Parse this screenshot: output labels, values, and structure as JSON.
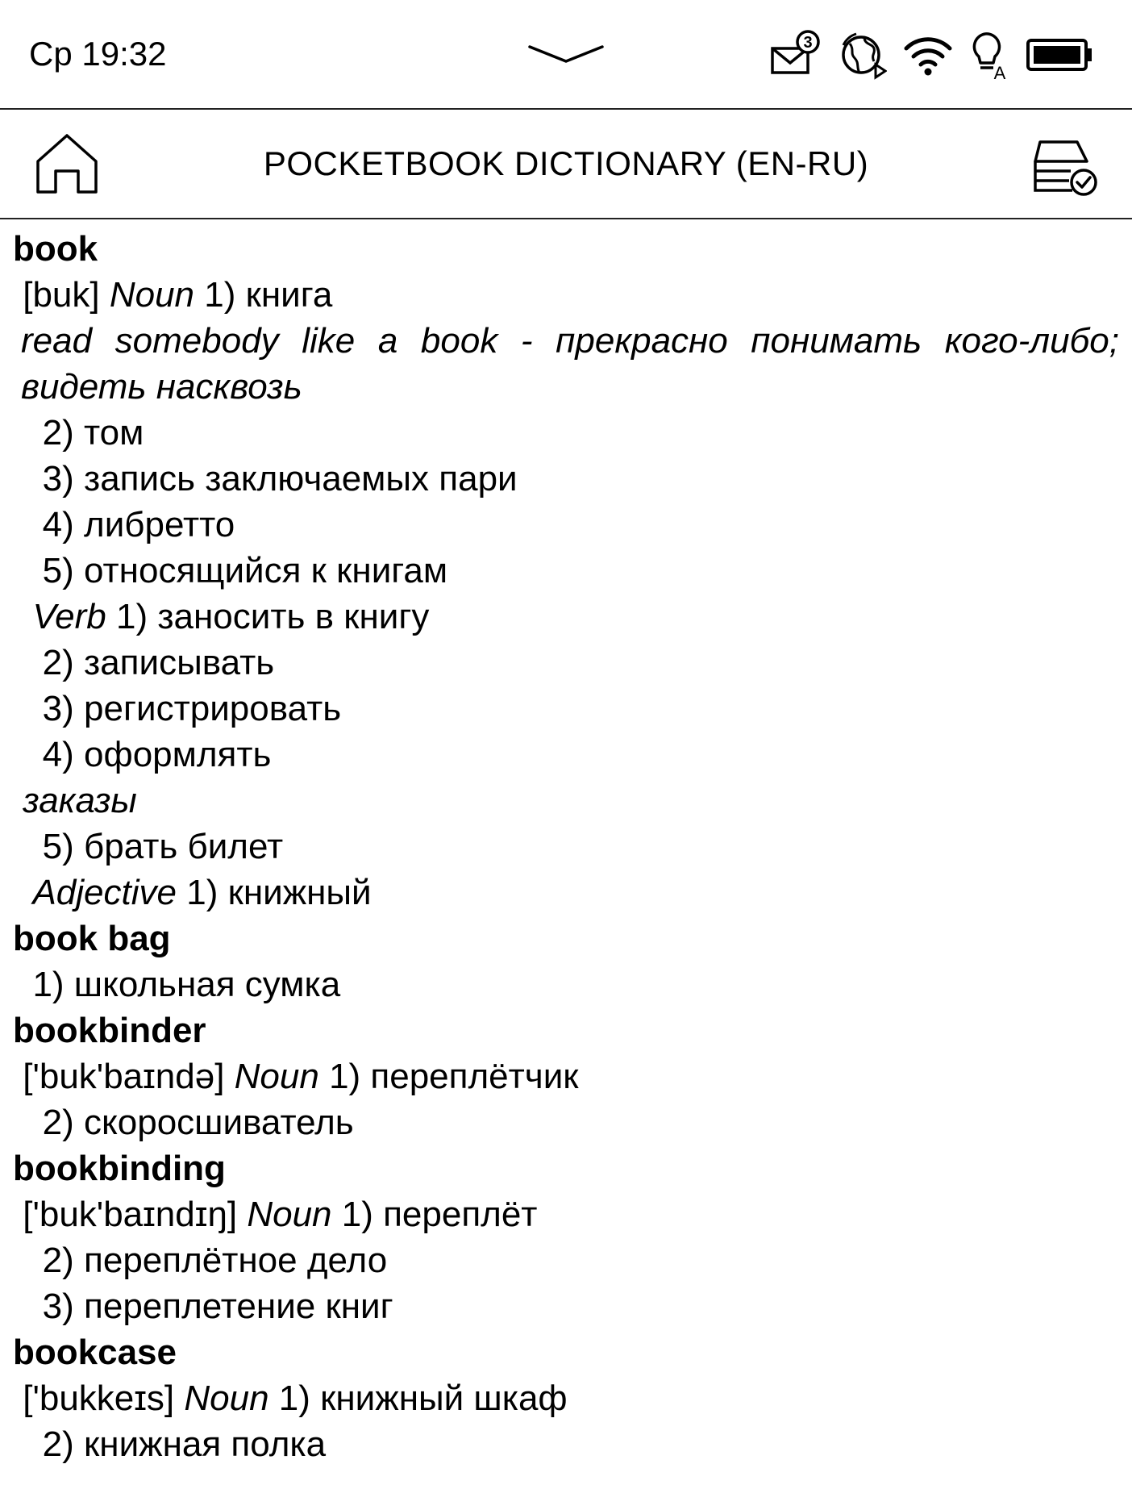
{
  "status_bar": {
    "time": "Ср 19:32",
    "mail_badge": "3"
  },
  "header": {
    "title": "POCKETBOOK DICTIONARY (EN-RU)"
  },
  "entries": [
    {
      "word": "book",
      "lines": [
        {
          "pre": " [buk] ",
          "em": "Noun",
          "post": " 1) книга"
        },
        {
          "pre": "",
          "em": "read somebody like a book - прекрасно понимать кого-либо; видеть насквозь",
          "post": "",
          "justify": true
        },
        {
          "pre": "   2) том",
          "em": "",
          "post": ""
        },
        {
          "pre": "   3) запись заключаемых пари",
          "em": "",
          "post": ""
        },
        {
          "pre": "   4) либретто",
          "em": "",
          "post": ""
        },
        {
          "pre": "   5) относящийся к книгам",
          "em": "",
          "post": ""
        },
        {
          "pre": "  ",
          "em": "Verb",
          "post": " 1) заносить в книгу"
        },
        {
          "pre": "   2) записывать",
          "em": "",
          "post": ""
        },
        {
          "pre": "   3) регистрировать",
          "em": "",
          "post": ""
        },
        {
          "pre": "   4) оформлять",
          "em": "",
          "post": ""
        },
        {
          "pre": " ",
          "em": "заказы",
          "post": ""
        },
        {
          "pre": "   5) брать билет",
          "em": "",
          "post": ""
        },
        {
          "pre": "  ",
          "em": "Adjective",
          "post": " 1) книжный"
        }
      ]
    },
    {
      "word": "book bag",
      "lines": [
        {
          "pre": "  1) школьная сумка",
          "em": "",
          "post": ""
        }
      ]
    },
    {
      "word": "bookbinder",
      "lines": [
        {
          "pre": " ['buk'baɪndə] ",
          "em": "Noun",
          "post": " 1) переплётчик"
        },
        {
          "pre": "   2) скоросшиватель",
          "em": "",
          "post": ""
        }
      ]
    },
    {
      "word": "bookbinding",
      "lines": [
        {
          "pre": " ['buk'baɪndɪŋ] ",
          "em": "Noun",
          "post": " 1) переплёт"
        },
        {
          "pre": "   2) переплётное дело",
          "em": "",
          "post": ""
        },
        {
          "pre": "   3) переплетение книг",
          "em": "",
          "post": ""
        }
      ]
    },
    {
      "word": "bookcase",
      "lines": [
        {
          "pre": " ['bukkeɪs] ",
          "em": "Noun",
          "post": " 1) книжный шкаф"
        },
        {
          "pre": "   2) книжная полка",
          "em": "",
          "post": ""
        }
      ]
    }
  ]
}
